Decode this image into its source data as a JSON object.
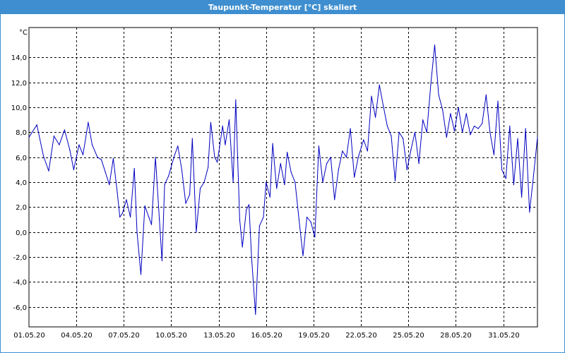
{
  "window": {
    "title": "Taupunkt-Temperatur [°C] skaliert"
  },
  "chart_data": {
    "type": "line",
    "ylabel": "°C",
    "ylim": [
      -7.6,
      16.4
    ],
    "xlim": [
      "01.05.20 00:00",
      "02.06.20 04:00"
    ],
    "grid": true,
    "y_ticks": [
      "14,0",
      "12,0",
      "10,0",
      "8,0",
      "6,0",
      "4,0",
      "2,0",
      "0,0",
      "-2,0",
      "-4,0",
      "-6,0"
    ],
    "y_tick_values": [
      14,
      12,
      10,
      8,
      6,
      4,
      2,
      0,
      -2,
      -4,
      -6
    ],
    "x_ticks": [
      "01.05.20",
      "04.05.20",
      "07.05.20",
      "10.05.20",
      "13.05.20",
      "16.05.20",
      "19.05.20",
      "22.05.20",
      "25.05.20",
      "28.05.20",
      "31.05.20"
    ],
    "series": [
      {
        "color": "#0000c0",
        "points": [
          [
            "01.05.20 00:00",
            7.6
          ],
          [
            "01.05.20 12:00",
            8.6
          ],
          [
            "01.05.20 22:00",
            6.1
          ],
          [
            "02.05.20 06:00",
            4.9
          ],
          [
            "02.05.20 14:00",
            7.7
          ],
          [
            "02.05.20 22:00",
            7.0
          ],
          [
            "03.05.20 06:00",
            8.2
          ],
          [
            "03.05.20 14:00",
            6.6
          ],
          [
            "03.05.20 20:00",
            5.0
          ],
          [
            "04.05.20 04:00",
            7.0
          ],
          [
            "04.05.20 10:00",
            6.2
          ],
          [
            "04.05.20 18:00",
            8.8
          ],
          [
            "05.05.20 00:00",
            7.0
          ],
          [
            "05.05.20 08:00",
            6.0
          ],
          [
            "05.05.20 14:00",
            5.8
          ],
          [
            "05.05.20 20:00",
            4.8
          ],
          [
            "06.05.20 02:00",
            3.8
          ],
          [
            "06.05.20 08:00",
            5.9
          ],
          [
            "06.05.20 14:00",
            3.2
          ],
          [
            "06.05.20 18:00",
            1.2
          ],
          [
            "06.05.20 22:00",
            1.5
          ],
          [
            "07.05.20 04:00",
            2.6
          ],
          [
            "07.05.20 10:00",
            1.2
          ],
          [
            "07.05.20 16:00",
            5.1
          ],
          [
            "07.05.20 20:00",
            0.0
          ],
          [
            "08.05.20 02:00",
            -3.4
          ],
          [
            "08.05.20 08:00",
            2.1
          ],
          [
            "08.05.20 14:00",
            1.2
          ],
          [
            "08.05.20 18:00",
            0.6
          ],
          [
            "09.05.20 00:00",
            6.0
          ],
          [
            "09.05.20 06:00",
            1.0
          ],
          [
            "09.05.20 10:00",
            -2.3
          ],
          [
            "09.05.20 14:00",
            3.8
          ],
          [
            "09.05.20 20:00",
            4.5
          ],
          [
            "10.05.20 04:00",
            6.0
          ],
          [
            "10.05.20 10:00",
            6.9
          ],
          [
            "10.05.20 16:00",
            5.0
          ],
          [
            "10.05.20 22:00",
            2.3
          ],
          [
            "11.05.20 04:00",
            3.0
          ],
          [
            "11.05.20 08:00",
            7.5
          ],
          [
            "11.05.20 14:00",
            0.0
          ],
          [
            "11.05.20 20:00",
            3.5
          ],
          [
            "12.05.20 02:00",
            4.0
          ],
          [
            "12.05.20 08:00",
            5.2
          ],
          [
            "12.05.20 12:00",
            8.8
          ],
          [
            "12.05.20 18:00",
            6.0
          ],
          [
            "12.05.20 22:00",
            5.6
          ],
          [
            "13.05.20 06:00",
            8.5
          ],
          [
            "13.05.20 10:00",
            7.0
          ],
          [
            "13.05.20 16:00",
            9.0
          ],
          [
            "13.05.20 22:00",
            4.0
          ],
          [
            "14.05.20 02:00",
            10.6
          ],
          [
            "14.05.20 08:00",
            1.0
          ],
          [
            "14.05.20 12:00",
            -1.2
          ],
          [
            "14.05.20 18:00",
            1.8
          ],
          [
            "14.05.20 22:00",
            2.2
          ],
          [
            "15.05.20 02:00",
            -2.0
          ],
          [
            "15.05.20 08:00",
            -6.6
          ],
          [
            "15.05.20 14:00",
            0.5
          ],
          [
            "15.05.20 20:00",
            1.2
          ],
          [
            "16.05.20 00:00",
            4.0
          ],
          [
            "16.05.20 06:00",
            2.8
          ],
          [
            "16.05.20 10:00",
            7.1
          ],
          [
            "16.05.20 16:00",
            3.5
          ],
          [
            "16.05.20 22:00",
            5.5
          ],
          [
            "17.05.20 04:00",
            3.8
          ],
          [
            "17.05.20 08:00",
            6.4
          ],
          [
            "17.05.20 14:00",
            4.8
          ],
          [
            "17.05.20 20:00",
            4.0
          ],
          [
            "18.05.20 02:00",
            1.0
          ],
          [
            "18.05.20 08:00",
            -1.9
          ],
          [
            "18.05.20 14:00",
            1.2
          ],
          [
            "18.05.20 20:00",
            0.8
          ],
          [
            "19.05.20 02:00",
            -0.4
          ],
          [
            "19.05.20 08:00",
            6.9
          ],
          [
            "19.05.20 14:00",
            4.0
          ],
          [
            "19.05.20 20:00",
            5.5
          ],
          [
            "20.05.20 02:00",
            6.0
          ],
          [
            "20.05.20 08:00",
            2.6
          ],
          [
            "20.05.20 14:00",
            5.0
          ],
          [
            "20.05.20 20:00",
            6.5
          ],
          [
            "21.05.20 02:00",
            6.0
          ],
          [
            "21.05.20 08:00",
            8.3
          ],
          [
            "21.05.20 14:00",
            4.4
          ],
          [
            "21.05.20 20:00",
            6.0
          ],
          [
            "22.05.20 04:00",
            7.4
          ],
          [
            "22.05.20 10:00",
            6.5
          ],
          [
            "22.05.20 16:00",
            10.9
          ],
          [
            "22.05.20 22:00",
            9.2
          ],
          [
            "23.05.20 04:00",
            11.8
          ],
          [
            "23.05.20 10:00",
            10.1
          ],
          [
            "23.05.20 16:00",
            8.5
          ],
          [
            "23.05.20 22:00",
            7.7
          ],
          [
            "24.05.20 04:00",
            4.1
          ],
          [
            "24.05.20 10:00",
            8.0
          ],
          [
            "24.05.20 16:00",
            7.5
          ],
          [
            "24.05.20 22:00",
            5.0
          ],
          [
            "25.05.20 04:00",
            6.6
          ],
          [
            "25.05.20 10:00",
            8.0
          ],
          [
            "25.05.20 16:00",
            5.5
          ],
          [
            "25.05.20 22:00",
            9.0
          ],
          [
            "26.05.20 04:00",
            8.0
          ],
          [
            "26.05.20 10:00",
            11.8
          ],
          [
            "26.05.20 16:00",
            15.0
          ],
          [
            "26.05.20 22:00",
            11.0
          ],
          [
            "27.05.20 04:00",
            9.8
          ],
          [
            "27.05.20 10:00",
            7.6
          ],
          [
            "27.05.20 16:00",
            9.5
          ],
          [
            "27.05.20 22:00",
            8.1
          ],
          [
            "28.05.20 04:00",
            10.0
          ],
          [
            "28.05.20 10:00",
            8.0
          ],
          [
            "28.05.20 16:00",
            9.5
          ],
          [
            "28.05.20 22:00",
            7.8
          ],
          [
            "29.05.20 04:00",
            8.5
          ],
          [
            "29.05.20 10:00",
            8.3
          ],
          [
            "29.05.20 16:00",
            8.7
          ],
          [
            "29.05.20 22:00",
            11.0
          ],
          [
            "30.05.20 04:00",
            8.0
          ],
          [
            "30.05.20 10:00",
            6.2
          ],
          [
            "30.05.20 16:00",
            10.5
          ],
          [
            "30.05.20 22:00",
            5.0
          ],
          [
            "31.05.20 04:00",
            4.3
          ],
          [
            "31.05.20 10:00",
            8.5
          ],
          [
            "31.05.20 16:00",
            3.8
          ],
          [
            "31.05.20 22:00",
            7.5
          ],
          [
            "01.06.20 04:00",
            2.8
          ],
          [
            "01.06.20 10:00",
            8.3
          ],
          [
            "01.06.20 16:00",
            1.6
          ],
          [
            "01.06.20 22:00",
            4.5
          ],
          [
            "02.06.20 04:00",
            7.6
          ]
        ]
      }
    ]
  }
}
